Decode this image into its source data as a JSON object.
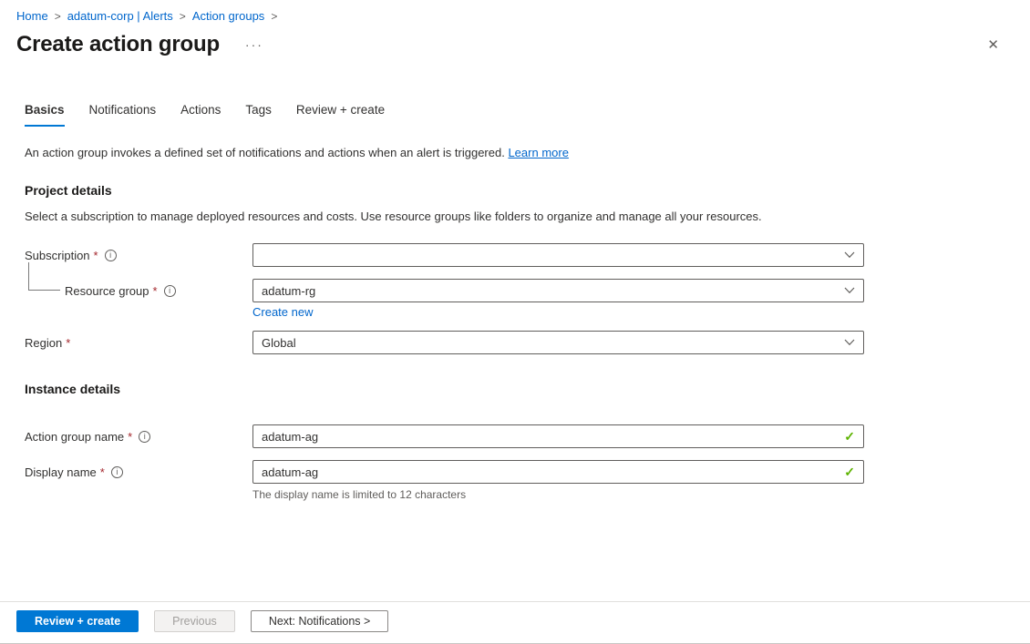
{
  "breadcrumb": {
    "items": [
      {
        "label": "Home"
      },
      {
        "label": "adatum-corp | Alerts"
      },
      {
        "label": "Action groups"
      }
    ],
    "separator": ">"
  },
  "header": {
    "title": "Create action group",
    "more": "···",
    "close": "✕"
  },
  "tabs": [
    {
      "label": "Basics"
    },
    {
      "label": "Notifications"
    },
    {
      "label": "Actions"
    },
    {
      "label": "Tags"
    },
    {
      "label": "Review + create"
    }
  ],
  "intro": {
    "text": "An action group invokes a defined set of notifications and actions when an alert is triggered.",
    "link": "Learn more"
  },
  "project": {
    "heading": "Project details",
    "description": "Select a subscription to manage deployed resources and costs. Use resource groups like folders to organize and manage all your resources.",
    "subscription_label": "Subscription",
    "subscription_value": "",
    "resource_group_label": "Resource group",
    "resource_group_value": "adatum-rg",
    "create_new": "Create new",
    "region_label": "Region",
    "region_value": "Global"
  },
  "instance": {
    "heading": "Instance details",
    "action_group_name_label": "Action group name",
    "action_group_name_value": "adatum-ag",
    "display_name_label": "Display name",
    "display_name_value": "adatum-ag",
    "display_name_helper": "The display name is limited to 12 characters"
  },
  "footer": {
    "review_create": "Review + create",
    "previous": "Previous",
    "next": "Next: Notifications >"
  },
  "misc": {
    "required": "*",
    "info": "i",
    "check": "✓"
  },
  "colors": {
    "accent": "#0078d4",
    "link": "#0066cc",
    "required": "#a4262c",
    "valid_green": "#5db300"
  }
}
